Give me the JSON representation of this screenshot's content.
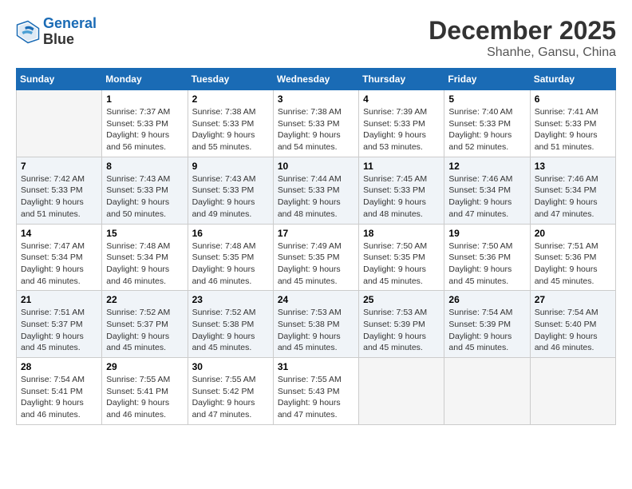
{
  "header": {
    "logo_line1": "General",
    "logo_line2": "Blue",
    "month": "December 2025",
    "location": "Shanhe, Gansu, China"
  },
  "columns": [
    "Sunday",
    "Monday",
    "Tuesday",
    "Wednesday",
    "Thursday",
    "Friday",
    "Saturday"
  ],
  "weeks": [
    [
      {
        "day": "",
        "info": ""
      },
      {
        "day": "1",
        "info": "Sunrise: 7:37 AM\nSunset: 5:33 PM\nDaylight: 9 hours\nand 56 minutes."
      },
      {
        "day": "2",
        "info": "Sunrise: 7:38 AM\nSunset: 5:33 PM\nDaylight: 9 hours\nand 55 minutes."
      },
      {
        "day": "3",
        "info": "Sunrise: 7:38 AM\nSunset: 5:33 PM\nDaylight: 9 hours\nand 54 minutes."
      },
      {
        "day": "4",
        "info": "Sunrise: 7:39 AM\nSunset: 5:33 PM\nDaylight: 9 hours\nand 53 minutes."
      },
      {
        "day": "5",
        "info": "Sunrise: 7:40 AM\nSunset: 5:33 PM\nDaylight: 9 hours\nand 52 minutes."
      },
      {
        "day": "6",
        "info": "Sunrise: 7:41 AM\nSunset: 5:33 PM\nDaylight: 9 hours\nand 51 minutes."
      }
    ],
    [
      {
        "day": "7",
        "info": "Sunrise: 7:42 AM\nSunset: 5:33 PM\nDaylight: 9 hours\nand 51 minutes."
      },
      {
        "day": "8",
        "info": "Sunrise: 7:43 AM\nSunset: 5:33 PM\nDaylight: 9 hours\nand 50 minutes."
      },
      {
        "day": "9",
        "info": "Sunrise: 7:43 AM\nSunset: 5:33 PM\nDaylight: 9 hours\nand 49 minutes."
      },
      {
        "day": "10",
        "info": "Sunrise: 7:44 AM\nSunset: 5:33 PM\nDaylight: 9 hours\nand 48 minutes."
      },
      {
        "day": "11",
        "info": "Sunrise: 7:45 AM\nSunset: 5:33 PM\nDaylight: 9 hours\nand 48 minutes."
      },
      {
        "day": "12",
        "info": "Sunrise: 7:46 AM\nSunset: 5:34 PM\nDaylight: 9 hours\nand 47 minutes."
      },
      {
        "day": "13",
        "info": "Sunrise: 7:46 AM\nSunset: 5:34 PM\nDaylight: 9 hours\nand 47 minutes."
      }
    ],
    [
      {
        "day": "14",
        "info": "Sunrise: 7:47 AM\nSunset: 5:34 PM\nDaylight: 9 hours\nand 46 minutes."
      },
      {
        "day": "15",
        "info": "Sunrise: 7:48 AM\nSunset: 5:34 PM\nDaylight: 9 hours\nand 46 minutes."
      },
      {
        "day": "16",
        "info": "Sunrise: 7:48 AM\nSunset: 5:35 PM\nDaylight: 9 hours\nand 46 minutes."
      },
      {
        "day": "17",
        "info": "Sunrise: 7:49 AM\nSunset: 5:35 PM\nDaylight: 9 hours\nand 45 minutes."
      },
      {
        "day": "18",
        "info": "Sunrise: 7:50 AM\nSunset: 5:35 PM\nDaylight: 9 hours\nand 45 minutes."
      },
      {
        "day": "19",
        "info": "Sunrise: 7:50 AM\nSunset: 5:36 PM\nDaylight: 9 hours\nand 45 minutes."
      },
      {
        "day": "20",
        "info": "Sunrise: 7:51 AM\nSunset: 5:36 PM\nDaylight: 9 hours\nand 45 minutes."
      }
    ],
    [
      {
        "day": "21",
        "info": "Sunrise: 7:51 AM\nSunset: 5:37 PM\nDaylight: 9 hours\nand 45 minutes."
      },
      {
        "day": "22",
        "info": "Sunrise: 7:52 AM\nSunset: 5:37 PM\nDaylight: 9 hours\nand 45 minutes."
      },
      {
        "day": "23",
        "info": "Sunrise: 7:52 AM\nSunset: 5:38 PM\nDaylight: 9 hours\nand 45 minutes."
      },
      {
        "day": "24",
        "info": "Sunrise: 7:53 AM\nSunset: 5:38 PM\nDaylight: 9 hours\nand 45 minutes."
      },
      {
        "day": "25",
        "info": "Sunrise: 7:53 AM\nSunset: 5:39 PM\nDaylight: 9 hours\nand 45 minutes."
      },
      {
        "day": "26",
        "info": "Sunrise: 7:54 AM\nSunset: 5:39 PM\nDaylight: 9 hours\nand 45 minutes."
      },
      {
        "day": "27",
        "info": "Sunrise: 7:54 AM\nSunset: 5:40 PM\nDaylight: 9 hours\nand 46 minutes."
      }
    ],
    [
      {
        "day": "28",
        "info": "Sunrise: 7:54 AM\nSunset: 5:41 PM\nDaylight: 9 hours\nand 46 minutes."
      },
      {
        "day": "29",
        "info": "Sunrise: 7:55 AM\nSunset: 5:41 PM\nDaylight: 9 hours\nand 46 minutes."
      },
      {
        "day": "30",
        "info": "Sunrise: 7:55 AM\nSunset: 5:42 PM\nDaylight: 9 hours\nand 47 minutes."
      },
      {
        "day": "31",
        "info": "Sunrise: 7:55 AM\nSunset: 5:43 PM\nDaylight: 9 hours\nand 47 minutes."
      },
      {
        "day": "",
        "info": ""
      },
      {
        "day": "",
        "info": ""
      },
      {
        "day": "",
        "info": ""
      }
    ]
  ]
}
